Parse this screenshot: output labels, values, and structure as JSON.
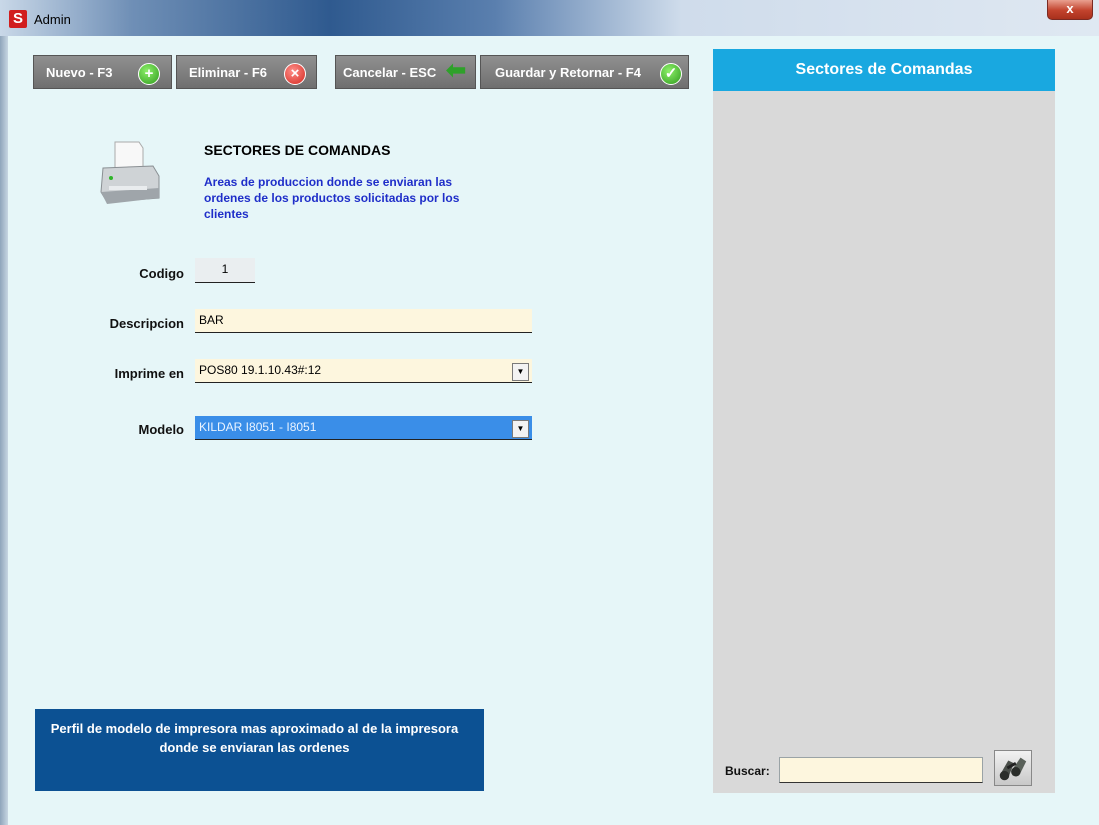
{
  "window": {
    "title": "Admin",
    "app_icon_letter": "S",
    "close_label": "x"
  },
  "toolbar": {
    "nuevo": "Nuevo - F3",
    "eliminar": "Eliminar - F6",
    "cancelar": "Cancelar - ESC",
    "guardar": "Guardar y Retornar - F4"
  },
  "form": {
    "title": "SECTORES DE COMANDAS",
    "description": "Areas de produccion donde se enviaran las ordenes de los productos solicitadas por los clientes",
    "fields": {
      "codigo_label": "Codigo",
      "codigo_value": "1",
      "descripcion_label": "Descripcion",
      "descripcion_value": "BAR",
      "imprime_label": "Imprime en",
      "imprime_value": "POS80 19.1.10.43#:12",
      "modelo_label": "Modelo",
      "modelo_value": "KILDAR I8051 - I8051"
    },
    "info": "Perfil de modelo de impresora mas aproximado al de la impresora donde se enviaran las ordenes"
  },
  "panel": {
    "title": "Sectores de Comandas",
    "buscar_label": "Buscar:",
    "buscar_value": ""
  },
  "icons": {
    "nuevo": "plus-icon",
    "eliminar": "x-icon",
    "cancelar": "arrow-left-icon",
    "guardar": "check-icon",
    "search": "binoculars-icon"
  },
  "colors": {
    "accent_blue": "#19a8e0",
    "info_blue": "#0c5193",
    "panel_gray": "#d9d9d9"
  }
}
